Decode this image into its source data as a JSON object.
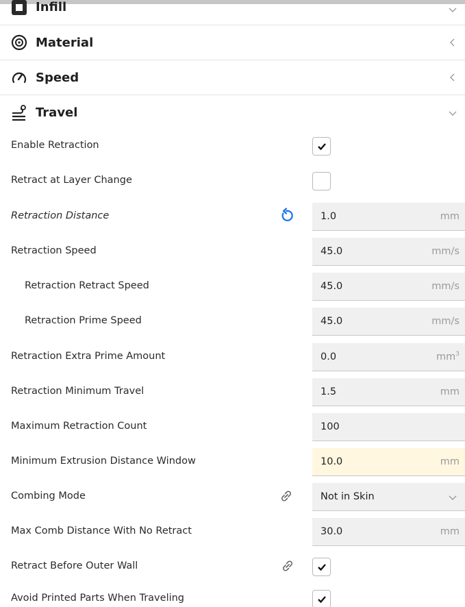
{
  "sections": {
    "cut": {
      "title": "Infill",
      "chevron": "chevron-down-icon"
    },
    "material": {
      "title": "Material",
      "chevron": "chevron-left-icon"
    },
    "speed": {
      "title": "Speed",
      "chevron": "chevron-left-icon"
    },
    "travel": {
      "title": "Travel",
      "chevron": "chevron-down-icon"
    }
  },
  "settings": [
    {
      "label": "Enable Retraction",
      "type": "checkbox",
      "checked": true
    },
    {
      "label": "Retract at Layer Change",
      "type": "checkbox",
      "checked": false
    },
    {
      "label": "Retraction Distance",
      "type": "number",
      "value": "1.0",
      "unit": "mm",
      "side_icon": "reset-icon",
      "italic": true
    },
    {
      "label": "Retraction Speed",
      "type": "number",
      "value": "45.0",
      "unit": "mm/s"
    },
    {
      "label": "Retraction Retract Speed",
      "type": "number",
      "value": "45.0",
      "unit": "mm/s",
      "indent": true
    },
    {
      "label": "Retraction Prime Speed",
      "type": "number",
      "value": "45.0",
      "unit": "mm/s",
      "indent": true
    },
    {
      "label": "Retraction Extra Prime Amount",
      "type": "number",
      "value": "0.0",
      "unit": "mm",
      "unit_sup": "3"
    },
    {
      "label": "Retraction Minimum Travel",
      "type": "number",
      "value": "1.5",
      "unit": "mm"
    },
    {
      "label": "Maximum Retraction Count",
      "type": "number",
      "value": "100",
      "unit": ""
    },
    {
      "label": "Minimum Extrusion Distance Window",
      "type": "number",
      "value": "10.0",
      "unit": "mm",
      "highlight": true,
      "highlight_color": "#fff7df"
    },
    {
      "label": "Combing Mode",
      "type": "select",
      "value": "Not in Skin",
      "side_icon": "link-icon"
    },
    {
      "label": "Max Comb Distance With No Retract",
      "type": "number",
      "value": "30.0",
      "unit": "mm"
    },
    {
      "label": "Retract Before Outer Wall",
      "type": "checkbox",
      "checked": true,
      "side_icon": "link-icon"
    },
    {
      "label": "Avoid Printed Parts When Traveling",
      "type": "checkbox",
      "checked": true
    }
  ],
  "colors": {
    "reset_icon": "#1a73e8",
    "text": "#1f1f1f",
    "muted": "#9a9a9a",
    "field_bg": "#f0f0f0"
  }
}
